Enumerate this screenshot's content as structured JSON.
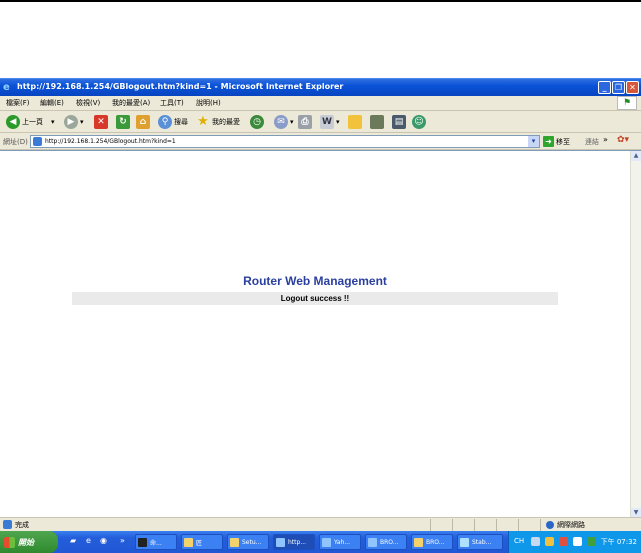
{
  "window": {
    "title": "http://192.168.1.254/GBlogout.htm?kind=1 - Microsoft Internet Explorer"
  },
  "menu": [
    "檔案(F)",
    "編輯(E)",
    "檢視(V)",
    "我的最愛(A)",
    "工具(T)",
    "說明(H)"
  ],
  "toolbar": {
    "back_label": "上一頁",
    "search_label": "搜尋",
    "favorites_label": "我的最愛"
  },
  "address": {
    "label": "網址(D)",
    "url": "http://192.168.1.254/GBlogout.htm?kind=1",
    "go_label": "移至",
    "links_label": "連結",
    "more": "»"
  },
  "page": {
    "heading": "Router Web Management",
    "message": "Logout success !!"
  },
  "status": {
    "text": "完成",
    "zone": "網際網路"
  },
  "taskbar": {
    "start_label": "開始",
    "tasks": [
      "命...",
      "匠",
      "Setu...",
      "http...",
      "Yah...",
      "BRO...",
      "BRO...",
      "Stab..."
    ],
    "lang": "CH",
    "clock": "下午 07:32"
  },
  "colors": {
    "heading": "#2b3f9f",
    "strip": "#eaeaea",
    "titlebar": "#0a52d8"
  }
}
